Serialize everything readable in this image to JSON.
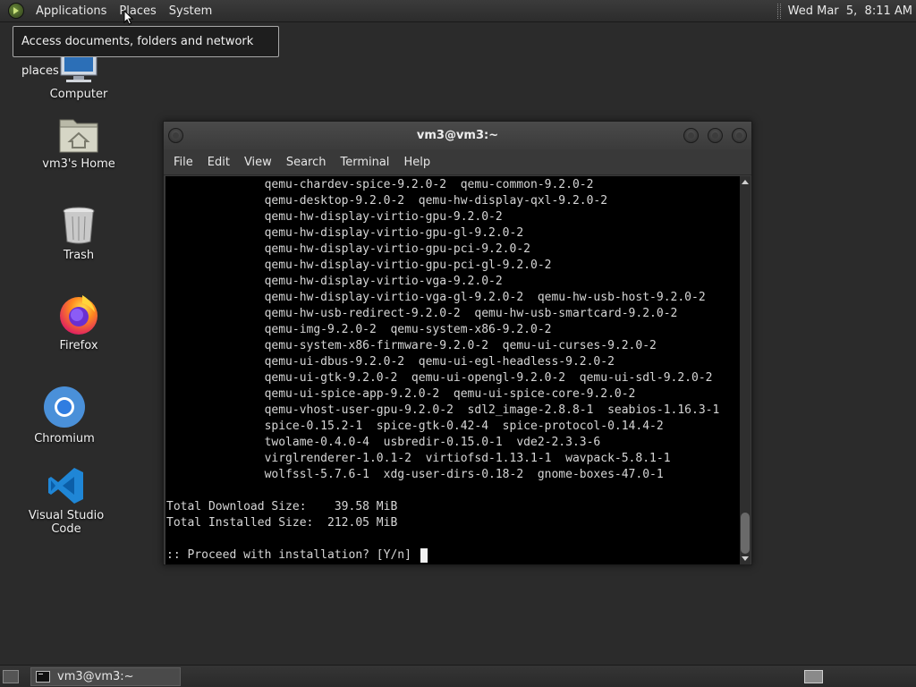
{
  "top_panel": {
    "menus": [
      "Applications",
      "Places",
      "System"
    ],
    "clock": "Wed Mar  5,  8:11 AM"
  },
  "tooltip": "Access documents, folders and network places",
  "desktop_icons": {
    "computer": "Computer",
    "home": "vm3's Home",
    "trash": "Trash",
    "firefox": "Firefox",
    "chromium": "Chromium",
    "vscode": "Visual Studio Code"
  },
  "window": {
    "title": "vm3@vm3:~",
    "menus": [
      "File",
      "Edit",
      "View",
      "Search",
      "Terminal",
      "Help"
    ],
    "terminal_lines": [
      "              qemu-chardev-spice-9.2.0-2  qemu-common-9.2.0-2",
      "              qemu-desktop-9.2.0-2  qemu-hw-display-qxl-9.2.0-2",
      "              qemu-hw-display-virtio-gpu-9.2.0-2",
      "              qemu-hw-display-virtio-gpu-gl-9.2.0-2",
      "              qemu-hw-display-virtio-gpu-pci-9.2.0-2",
      "              qemu-hw-display-virtio-gpu-pci-gl-9.2.0-2",
      "              qemu-hw-display-virtio-vga-9.2.0-2",
      "              qemu-hw-display-virtio-vga-gl-9.2.0-2  qemu-hw-usb-host-9.2.0-2",
      "              qemu-hw-usb-redirect-9.2.0-2  qemu-hw-usb-smartcard-9.2.0-2",
      "              qemu-img-9.2.0-2  qemu-system-x86-9.2.0-2",
      "              qemu-system-x86-firmware-9.2.0-2  qemu-ui-curses-9.2.0-2",
      "              qemu-ui-dbus-9.2.0-2  qemu-ui-egl-headless-9.2.0-2",
      "              qemu-ui-gtk-9.2.0-2  qemu-ui-opengl-9.2.0-2  qemu-ui-sdl-9.2.0-2",
      "              qemu-ui-spice-app-9.2.0-2  qemu-ui-spice-core-9.2.0-2",
      "              qemu-vhost-user-gpu-9.2.0-2  sdl2_image-2.8.8-1  seabios-1.16.3-1",
      "              spice-0.15.2-1  spice-gtk-0.42-4  spice-protocol-0.14.4-2",
      "              twolame-0.4.0-4  usbredir-0.15.0-1  vde2-2.3.3-6",
      "              virglrenderer-1.0.1-2  virtiofsd-1.13.1-1  wavpack-5.8.1-1",
      "              wolfssl-5.7.6-1  xdg-user-dirs-0.18-2  gnome-boxes-47.0-1",
      "",
      "Total Download Size:    39.58 MiB",
      "Total Installed Size:  212.05 MiB",
      "",
      ":: Proceed with installation? [Y/n] "
    ]
  },
  "taskbar": {
    "window_button": "vm3@vm3:~"
  }
}
